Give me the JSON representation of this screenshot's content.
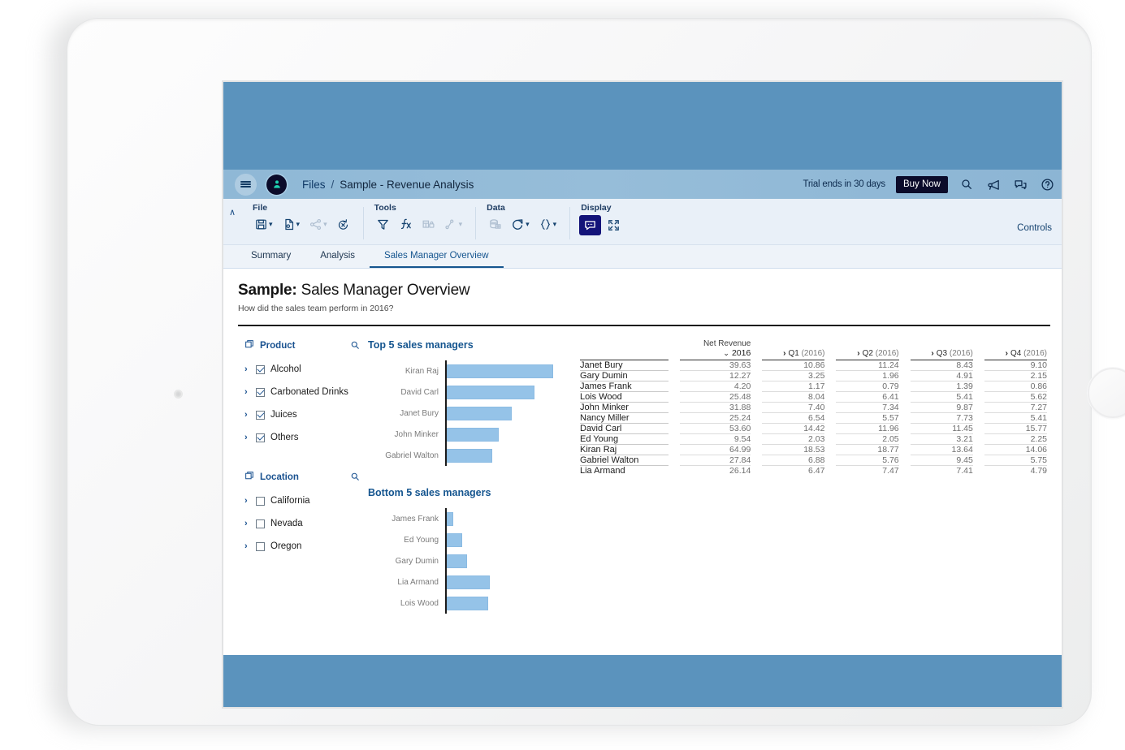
{
  "header": {
    "breadcrumb": {
      "root": "Files",
      "separator": "/",
      "current": "Sample - Revenue Analysis"
    },
    "trial_text": "Trial ends in 30 days",
    "buy_now_label": "Buy Now",
    "icons": [
      "menu-icon",
      "user-avatar-icon",
      "search-icon",
      "megaphone-icon",
      "chat-icon",
      "help-icon"
    ]
  },
  "ribbon": {
    "collapse_caret": "∧",
    "controls_label": "Controls",
    "groups": [
      {
        "label": "File",
        "items": [
          {
            "name": "save-button",
            "icon": "save-icon",
            "chevron": true,
            "disabled": false
          },
          {
            "name": "save-as-button",
            "icon": "save-as-icon",
            "chevron": true,
            "disabled": false
          },
          {
            "name": "share-button",
            "icon": "share-icon",
            "chevron": true,
            "disabled": true
          },
          {
            "name": "revert-button",
            "icon": "revert-icon",
            "chevron": false,
            "disabled": false
          }
        ]
      },
      {
        "label": "Tools",
        "items": [
          {
            "name": "filter-button",
            "icon": "funnel-icon",
            "chevron": false,
            "disabled": false
          },
          {
            "name": "calculation-button",
            "icon": "fx-icon",
            "chevron": false,
            "disabled": false
          },
          {
            "name": "table-lock-button",
            "icon": "table-lock-icon",
            "chevron": false,
            "disabled": true
          },
          {
            "name": "relationship-button",
            "icon": "node-link-icon",
            "chevron": true,
            "disabled": true
          }
        ]
      },
      {
        "label": "Data",
        "items": [
          {
            "name": "data-source-button",
            "icon": "database-icon",
            "chevron": false,
            "disabled": true
          },
          {
            "name": "refresh-button",
            "icon": "refresh-icon",
            "chevron": true,
            "disabled": false
          },
          {
            "name": "parameters-button",
            "icon": "braces-icon",
            "chevron": true,
            "disabled": false
          }
        ]
      },
      {
        "label": "Display",
        "items": [
          {
            "name": "comments-button",
            "icon": "comment-bubble-icon",
            "chevron": false,
            "disabled": false,
            "active": true
          },
          {
            "name": "fullscreen-button",
            "icon": "fullscreen-icon",
            "chevron": false,
            "disabled": false
          }
        ]
      }
    ]
  },
  "tabs": [
    {
      "label": "Summary",
      "selected": false
    },
    {
      "label": "Analysis",
      "selected": false
    },
    {
      "label": "Sales Manager Overview",
      "selected": true
    }
  ],
  "page": {
    "title_bold": "Sample:",
    "title_rest": " Sales Manager Overview",
    "subtitle": "How did the sales team perform in 2016?"
  },
  "filters": [
    {
      "name": "Product",
      "icon": "hierarchy-icon",
      "search_icon": "search-icon",
      "items": [
        {
          "label": "Alcohol",
          "checked": true
        },
        {
          "label": "Carbonated Drinks",
          "checked": true
        },
        {
          "label": "Juices",
          "checked": true
        },
        {
          "label": "Others",
          "checked": true
        }
      ]
    },
    {
      "name": "Location",
      "icon": "hierarchy-icon",
      "search_icon": "search-icon",
      "items": [
        {
          "label": "California",
          "checked": false
        },
        {
          "label": "Nevada",
          "checked": false
        },
        {
          "label": "Oregon",
          "checked": false
        }
      ]
    }
  ],
  "chart_data": [
    {
      "type": "bar",
      "orientation": "horizontal",
      "title": "Top 5 sales managers",
      "categories": [
        "Kiran Raj",
        "David Carl",
        "Janet Bury",
        "John Minker",
        "Gabriel Walton"
      ],
      "values": [
        64.99,
        53.6,
        39.63,
        31.88,
        27.84
      ],
      "xlabel": "",
      "ylabel": "",
      "xlim": [
        0,
        65
      ],
      "grid": false,
      "legend": false,
      "series_color": "#95c3e8"
    },
    {
      "type": "bar",
      "orientation": "horizontal",
      "title": "Bottom 5 sales managers",
      "categories": [
        "James Frank",
        "Ed Young",
        "Gary Dumin",
        "Lia Armand",
        "Lois Wood"
      ],
      "values": [
        4.2,
        9.54,
        12.27,
        26.14,
        25.48
      ],
      "xlabel": "",
      "ylabel": "",
      "xlim": [
        0,
        65
      ],
      "grid": false,
      "legend": false,
      "series_color": "#95c3e8"
    }
  ],
  "table": {
    "measure_label": "Net Revenue",
    "year_header": "2016",
    "year_caret": "⌄",
    "quarter_caret": "›",
    "quarter_headers": [
      {
        "q": "Q1",
        "year": "(2016)"
      },
      {
        "q": "Q2",
        "year": "(2016)"
      },
      {
        "q": "Q3",
        "year": "(2016)"
      },
      {
        "q": "Q4",
        "year": "(2016)"
      }
    ],
    "rows": [
      {
        "name": "Janet Bury",
        "total": "39.63",
        "q": [
          "10.86",
          "11.24",
          "8.43",
          "9.10"
        ]
      },
      {
        "name": "Gary Dumin",
        "total": "12.27",
        "q": [
          "3.25",
          "1.96",
          "4.91",
          "2.15"
        ]
      },
      {
        "name": "James Frank",
        "total": "4.20",
        "q": [
          "1.17",
          "0.79",
          "1.39",
          "0.86"
        ]
      },
      {
        "name": "Lois Wood",
        "total": "25.48",
        "q": [
          "8.04",
          "6.41",
          "5.41",
          "5.62"
        ]
      },
      {
        "name": "John Minker",
        "total": "31.88",
        "q": [
          "7.40",
          "7.34",
          "9.87",
          "7.27"
        ]
      },
      {
        "name": "Nancy Miller",
        "total": "25.24",
        "q": [
          "6.54",
          "5.57",
          "7.73",
          "5.41"
        ]
      },
      {
        "name": "David Carl",
        "total": "53.60",
        "q": [
          "14.42",
          "11.96",
          "11.45",
          "15.77"
        ]
      },
      {
        "name": "Ed Young",
        "total": "9.54",
        "q": [
          "2.03",
          "2.05",
          "3.21",
          "2.25"
        ]
      },
      {
        "name": "Kiran Raj",
        "total": "64.99",
        "q": [
          "18.53",
          "18.77",
          "13.64",
          "14.06"
        ]
      },
      {
        "name": "Gabriel Walton",
        "total": "27.84",
        "q": [
          "6.88",
          "5.76",
          "9.45",
          "5.75"
        ]
      },
      {
        "name": "Lia Armand",
        "total": "26.14",
        "q": [
          "6.47",
          "7.47",
          "7.41",
          "4.79"
        ]
      }
    ]
  },
  "colors": {
    "header_bar": "#8fb8d6",
    "screen_bg": "#5b93bd",
    "accent_blue": "#15558f",
    "bar_fill": "#95c3e8",
    "active_button": "#131379"
  }
}
